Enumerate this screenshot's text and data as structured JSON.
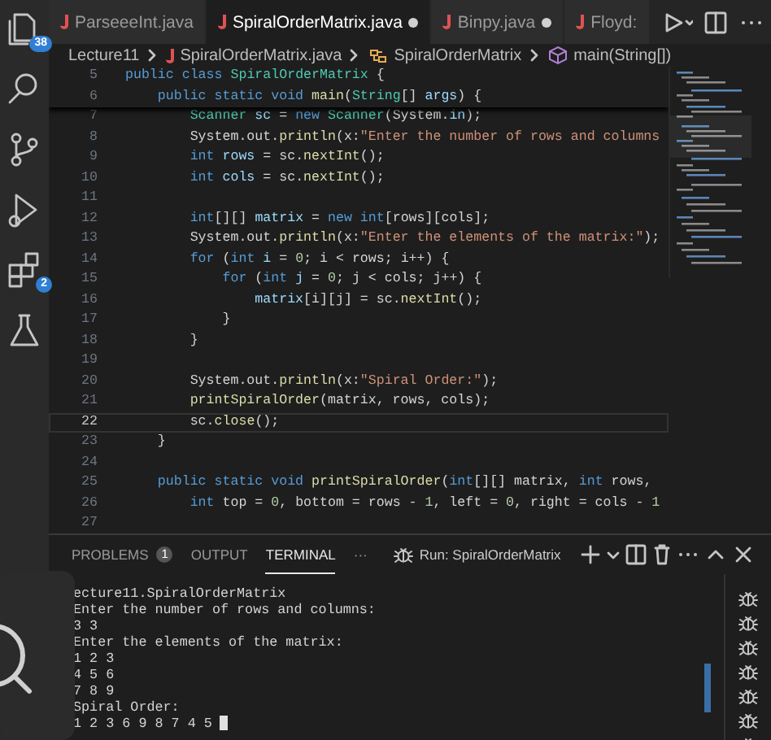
{
  "activity_bar": [
    {
      "kind": "files",
      "badge": "38",
      "selected": false
    },
    {
      "kind": "search",
      "selected": false
    },
    {
      "kind": "branch",
      "selected": false
    },
    {
      "kind": "run",
      "selected": false
    },
    {
      "kind": "extensions",
      "badge": "2",
      "selected": false
    },
    {
      "kind": "flask",
      "selected": false
    }
  ],
  "tabs": [
    {
      "label": "ParseeeInt.java",
      "selected": false,
      "modified": false
    },
    {
      "label": "SpiralOrderMatrix.java",
      "selected": true,
      "modified": true
    },
    {
      "label": "Binpy.java",
      "selected": false,
      "modified": true
    },
    {
      "label": "Floyd:",
      "selected": false,
      "modified": false
    }
  ],
  "breadcrumb": [
    {
      "kind": "folder",
      "label": "Lecture11"
    },
    {
      "kind": "java",
      "label": "SpiralOrderMatrix.java"
    },
    {
      "kind": "class",
      "label": "SpiralOrderMatrix"
    },
    {
      "kind": "method",
      "label": "main(String[])"
    }
  ],
  "sticky_lines": [
    {
      "number": "5",
      "segments": [
        {
          "kind": "kw",
          "text": "public class "
        },
        {
          "kind": "type",
          "text": "SpiralOrderMatrix"
        },
        {
          "kind": "plain",
          "text": " {"
        }
      ]
    },
    {
      "number": "6",
      "segments": [
        {
          "kind": "kw",
          "text": "    public static void "
        },
        {
          "kind": "fn",
          "text": "main"
        },
        {
          "kind": "plain",
          "text": "("
        },
        {
          "kind": "type",
          "text": "String"
        },
        {
          "kind": "plain",
          "text": "[] "
        },
        {
          "kind": "var",
          "text": "args"
        },
        {
          "kind": "plain",
          "text": ") {"
        }
      ]
    }
  ],
  "lines": [
    {
      "number": "7",
      "current": false,
      "segments": [
        {
          "kind": "type",
          "text": "        Scanner"
        },
        {
          "kind": "var",
          "text": " sc"
        },
        {
          "kind": "plain",
          "text": " = "
        },
        {
          "kind": "kw",
          "text": "new "
        },
        {
          "kind": "type",
          "text": "Scanner"
        },
        {
          "kind": "plain",
          "text": "(System."
        },
        {
          "kind": "var",
          "text": "in"
        },
        {
          "kind": "plain",
          "text": ");"
        }
      ]
    },
    {
      "number": "8",
      "current": false,
      "segments": [
        {
          "kind": "plain",
          "text": "        System.out."
        },
        {
          "kind": "fn",
          "text": "println"
        },
        {
          "kind": "plain",
          "text": "(x:"
        },
        {
          "kind": "str",
          "text": "\"Enter the number of rows and columns"
        }
      ]
    },
    {
      "number": "9",
      "current": false,
      "segments": [
        {
          "kind": "kw",
          "text": "        int "
        },
        {
          "kind": "var",
          "text": "rows"
        },
        {
          "kind": "plain",
          "text": " = sc."
        },
        {
          "kind": "fn",
          "text": "nextInt"
        },
        {
          "kind": "plain",
          "text": "();"
        }
      ]
    },
    {
      "number": "10",
      "current": false,
      "segments": [
        {
          "kind": "kw",
          "text": "        int "
        },
        {
          "kind": "var",
          "text": "cols"
        },
        {
          "kind": "plain",
          "text": " = sc."
        },
        {
          "kind": "fn",
          "text": "nextInt"
        },
        {
          "kind": "plain",
          "text": "();"
        }
      ]
    },
    {
      "number": "11",
      "current": false
    },
    {
      "number": "12",
      "current": false,
      "segments": [
        {
          "kind": "kw",
          "text": "        int"
        },
        {
          "kind": "plain",
          "text": "[][] "
        },
        {
          "kind": "var",
          "text": "matrix"
        },
        {
          "kind": "plain",
          "text": " = "
        },
        {
          "kind": "kw",
          "text": "new int"
        },
        {
          "kind": "plain",
          "text": "[rows][cols];"
        }
      ]
    },
    {
      "number": "13",
      "current": false,
      "segments": [
        {
          "kind": "plain",
          "text": "        System.out."
        },
        {
          "kind": "fn",
          "text": "println"
        },
        {
          "kind": "plain",
          "text": "(x:"
        },
        {
          "kind": "str",
          "text": "\"Enter the elements of the matrix:\""
        },
        {
          "kind": "plain",
          "text": ");"
        }
      ]
    },
    {
      "number": "14",
      "current": false,
      "segments": [
        {
          "kind": "kw",
          "text": "        for"
        },
        {
          "kind": "plain",
          "text": " ("
        },
        {
          "kind": "kw",
          "text": "int "
        },
        {
          "kind": "var",
          "text": "i"
        },
        {
          "kind": "plain",
          "text": " = "
        },
        {
          "kind": "num",
          "text": "0"
        },
        {
          "kind": "plain",
          "text": "; i < rows; i++) {"
        }
      ]
    },
    {
      "number": "15",
      "current": false,
      "segments": [
        {
          "kind": "kw",
          "text": "            for"
        },
        {
          "kind": "plain",
          "text": " ("
        },
        {
          "kind": "kw",
          "text": "int "
        },
        {
          "kind": "var",
          "text": "j"
        },
        {
          "kind": "plain",
          "text": " = "
        },
        {
          "kind": "num",
          "text": "0"
        },
        {
          "kind": "plain",
          "text": "; j < cols; j++) {"
        }
      ]
    },
    {
      "number": "16",
      "current": false,
      "segments": [
        {
          "kind": "var",
          "text": "                matrix"
        },
        {
          "kind": "plain",
          "text": "[i][j] = sc."
        },
        {
          "kind": "fn",
          "text": "nextInt"
        },
        {
          "kind": "plain",
          "text": "();"
        }
      ]
    },
    {
      "number": "17",
      "current": false,
      "segments": [
        {
          "kind": "plain",
          "text": "            }"
        }
      ]
    },
    {
      "number": "18",
      "current": false,
      "segments": [
        {
          "kind": "plain",
          "text": "        }"
        }
      ]
    },
    {
      "number": "19",
      "current": false
    },
    {
      "number": "20",
      "current": false,
      "segments": [
        {
          "kind": "plain",
          "text": "        System.out."
        },
        {
          "kind": "fn",
          "text": "println"
        },
        {
          "kind": "plain",
          "text": "(x:"
        },
        {
          "kind": "str",
          "text": "\"Spiral Order:\""
        },
        {
          "kind": "plain",
          "text": ");"
        }
      ]
    },
    {
      "number": "21",
      "current": false,
      "segments": [
        {
          "kind": "fn",
          "text": "        printSpiralOrder"
        },
        {
          "kind": "plain",
          "text": "(matrix, rows, cols);"
        }
      ]
    },
    {
      "number": "22",
      "current": true,
      "segments": [
        {
          "kind": "plain",
          "text": "        sc."
        },
        {
          "kind": "fn",
          "text": "close"
        },
        {
          "kind": "plain",
          "text": "();"
        }
      ]
    },
    {
      "number": "23",
      "current": false,
      "segments": [
        {
          "kind": "plain",
          "text": "    }"
        }
      ]
    },
    {
      "number": "24",
      "current": false
    },
    {
      "number": "25",
      "current": false,
      "segments": [
        {
          "kind": "kw",
          "text": "    public static void "
        },
        {
          "kind": "fn",
          "text": "printSpiralOrder"
        },
        {
          "kind": "plain",
          "text": "("
        },
        {
          "kind": "kw",
          "text": "int"
        },
        {
          "kind": "plain",
          "text": "[][] matrix, "
        },
        {
          "kind": "kw",
          "text": "int "
        },
        {
          "kind": "plain",
          "text": "rows,"
        }
      ]
    },
    {
      "number": "26",
      "current": false,
      "segments": [
        {
          "kind": "kw",
          "text": "        int "
        },
        {
          "kind": "plain",
          "text": "top = "
        },
        {
          "kind": "num",
          "text": "0"
        },
        {
          "kind": "plain",
          "text": ", bottom = rows - "
        },
        {
          "kind": "num",
          "text": "1"
        },
        {
          "kind": "plain",
          "text": ", left = "
        },
        {
          "kind": "num",
          "text": "0"
        },
        {
          "kind": "plain",
          "text": ", right = cols - "
        },
        {
          "kind": "num",
          "text": "1"
        }
      ]
    },
    {
      "number": "27",
      "current": false
    }
  ],
  "panel": {
    "tabs": [
      {
        "label": "PROBLEMS",
        "badge": "1",
        "selected": false
      },
      {
        "label": "OUTPUT",
        "selected": false
      },
      {
        "label": "TERMINAL",
        "selected": true
      }
    ],
    "more": "···",
    "terminal_name": "Run: SpiralOrderMatrix",
    "terminal_lines": [
      "ecture11.SpiralOrderMatrix",
      "Enter the number of rows and columns:",
      "3 3",
      "Enter the elements of the matrix:",
      "1 2 3",
      "4 5 6",
      "7 8 9",
      "Spiral Order:",
      "1 2 3 6 9 8 7 4 5"
    ]
  }
}
